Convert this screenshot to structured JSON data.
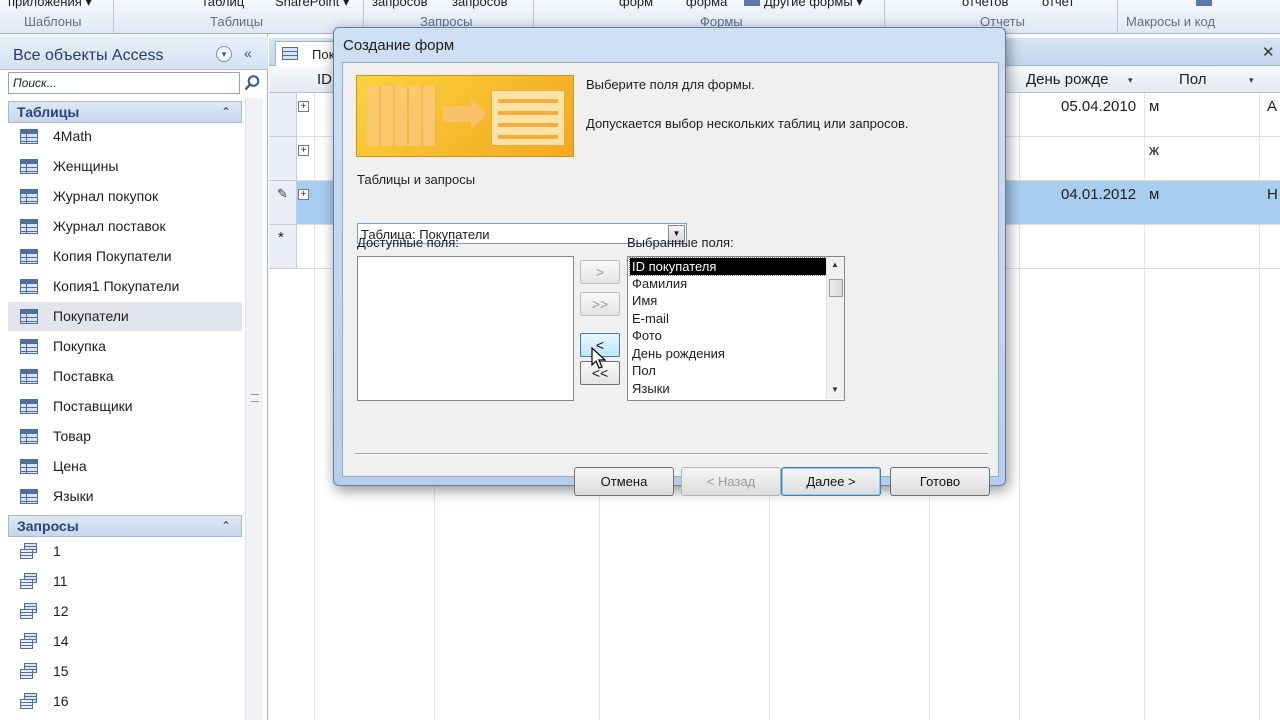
{
  "ribbon": {
    "texts": [
      {
        "id": "app-parts",
        "label": "приложения ▾"
      },
      {
        "id": "tables-btn",
        "label": "таблиц"
      },
      {
        "id": "sharepoint-btn",
        "label": "SharePoint ▾"
      },
      {
        "id": "queries-btn1",
        "label": "запросов"
      },
      {
        "id": "queries-btn2",
        "label": "запросов"
      },
      {
        "id": "form-btn",
        "label": "форм"
      },
      {
        "id": "form-btn2",
        "label": "форма"
      },
      {
        "id": "other-forms",
        "label": "Другие формы ▾"
      },
      {
        "id": "reports-btn",
        "label": "отчетов"
      },
      {
        "id": "report-btn",
        "label": "отчет"
      }
    ],
    "groups": {
      "templates": "Шаблоны",
      "tables": "Таблицы",
      "queries": "Запросы",
      "forms": "Формы",
      "reports": "Отчеты",
      "macros": "Макросы и код"
    }
  },
  "nav": {
    "title": "Все объекты Access",
    "search_placeholder": "Поиск...",
    "tables_header": "Таблицы",
    "tables": [
      "4Math",
      "Женщины",
      "Журнал покупок",
      "Журнал поставок",
      "Копия Покупатели",
      "Копия1 Покупатели",
      "Покупатели",
      "Покупка",
      "Поставка",
      "Поставщики",
      "Товар",
      "Цена",
      "Языки"
    ],
    "selected_table": "Покупатели",
    "queries_header": "Запросы",
    "queries": [
      "1",
      "11",
      "12",
      "14",
      "15",
      "16"
    ]
  },
  "document": {
    "tab_label": "Пок",
    "columns": {
      "id": "ID",
      "birthday": "День рожде",
      "gender": "Пол"
    },
    "rows": [
      {
        "birthday": "05.04.2010",
        "gender": "м",
        "extra": "А"
      },
      {
        "birthday": "",
        "gender": "ж",
        "extra": ""
      },
      {
        "birthday": "04.01.2012",
        "gender": "м",
        "extra": "Н"
      }
    ],
    "new_row_marker": "*"
  },
  "dialog": {
    "title": "Создание форм",
    "prompt": "Выберите поля для формы.",
    "hint": "Допускается выбор нескольких таблиц или запросов.",
    "source_label": "Таблицы и запросы",
    "source_value": "Таблица: Покупатели",
    "available_label": "Доступные поля:",
    "selected_label": "Выбранные поля:",
    "available_fields": [],
    "selected_fields": [
      "ID покупателя",
      "Фамилия",
      "Имя",
      "E-mail",
      "Фото",
      "День рождения",
      "Пол",
      "Языки"
    ],
    "selected_field_highlight": "ID покупателя",
    "move_buttons": {
      "add_one": ">",
      "add_all": ">>",
      "remove_one": "<",
      "remove_all": "<<"
    },
    "buttons": {
      "cancel": "Отмена",
      "back": "< Назад",
      "next": "Далее >",
      "finish": "Готово"
    }
  },
  "colors": {
    "selected_row": "#a9cdee",
    "ribbon_bg": "#dfe8f5",
    "nav_section": "#24457a",
    "wizard_art": "#f3a81e"
  }
}
